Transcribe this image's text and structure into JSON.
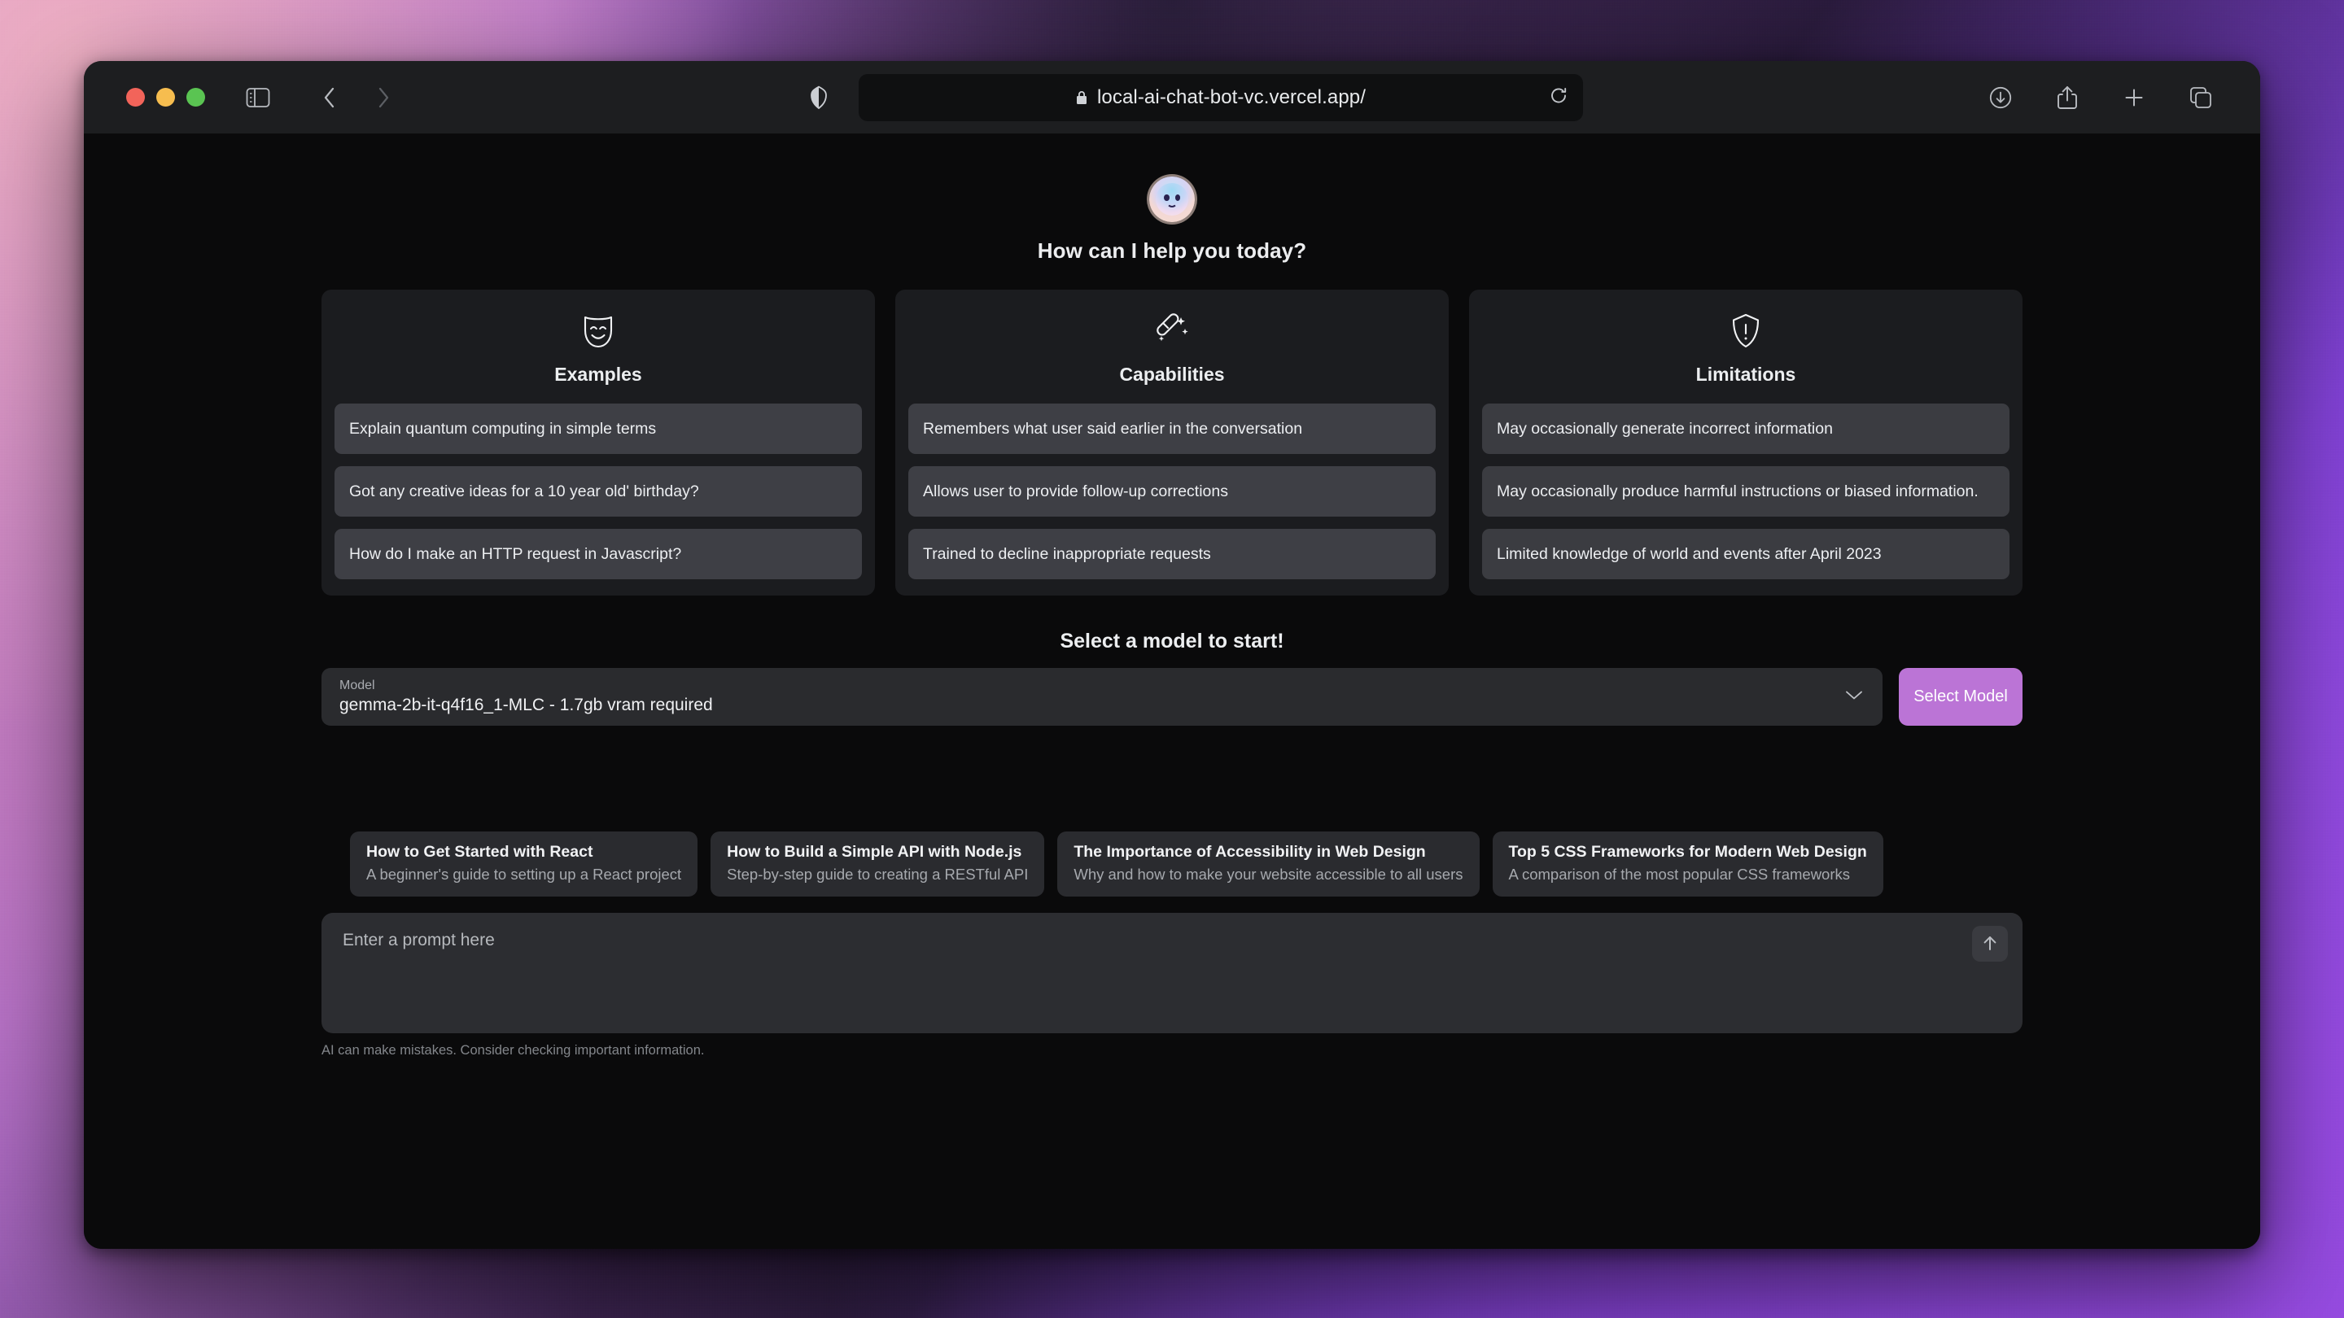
{
  "browser": {
    "window_controls": [
      "close",
      "minimize",
      "maximize"
    ],
    "url": "local-ai-chat-bot-vc.vercel.app/",
    "icons": {
      "sidebar": "sidebar-icon",
      "back": "back-chevron-icon",
      "forward": "forward-chevron-icon",
      "shield": "privacy-shield-icon",
      "lock": "lock-icon",
      "reload": "reload-icon",
      "downloads": "downloads-icon",
      "share": "share-icon",
      "new_tab": "plus-icon",
      "tab_overview": "tab-overview-icon"
    }
  },
  "hero": {
    "avatar": "bot-avatar",
    "greeting": "How can I help you today?"
  },
  "cards": [
    {
      "icon": "theater-mask-icon",
      "title": "Examples",
      "items": [
        "Explain quantum computing in simple terms",
        "Got any creative ideas for a 10 year old' birthday?",
        "How do I make an HTTP request in Javascript?"
      ]
    },
    {
      "icon": "magic-wand-icon",
      "title": "Capabilities",
      "items": [
        "Remembers what user said earlier in the conversation",
        "Allows user to provide follow-up corrections",
        "Trained to decline inappropriate requests"
      ]
    },
    {
      "icon": "shield-alert-icon",
      "title": "Limitations",
      "items": [
        "May occasionally generate incorrect information",
        "May occasionally produce harmful instructions or biased information.",
        "Limited knowledge of world and events after April 2023"
      ]
    }
  ],
  "model_section": {
    "heading": "Select a model to start!",
    "field_label": "Model",
    "selected_model": "gemma-2b-it-q4f16_1-MLC - 1.7gb vram required",
    "button_label": "Select Model",
    "button_color": "#bb74d6"
  },
  "suggestions": [
    {
      "title": "How to Get Started with React",
      "subtitle": "A beginner's guide to setting up a React project"
    },
    {
      "title": "How to Build a Simple API with Node.js",
      "subtitle": "Step-by-step guide to creating a RESTful API"
    },
    {
      "title": "The Importance of Accessibility in Web Design",
      "subtitle": "Why and how to make your website accessible to all users"
    },
    {
      "title": "Top 5 CSS Frameworks for Modern Web Design",
      "subtitle": "A comparison of the most popular CSS frameworks"
    }
  ],
  "prompt": {
    "placeholder": "Enter a prompt here",
    "value": "",
    "send_icon": "arrow-up-icon"
  },
  "footnote": "AI can make mistakes. Consider checking important information."
}
